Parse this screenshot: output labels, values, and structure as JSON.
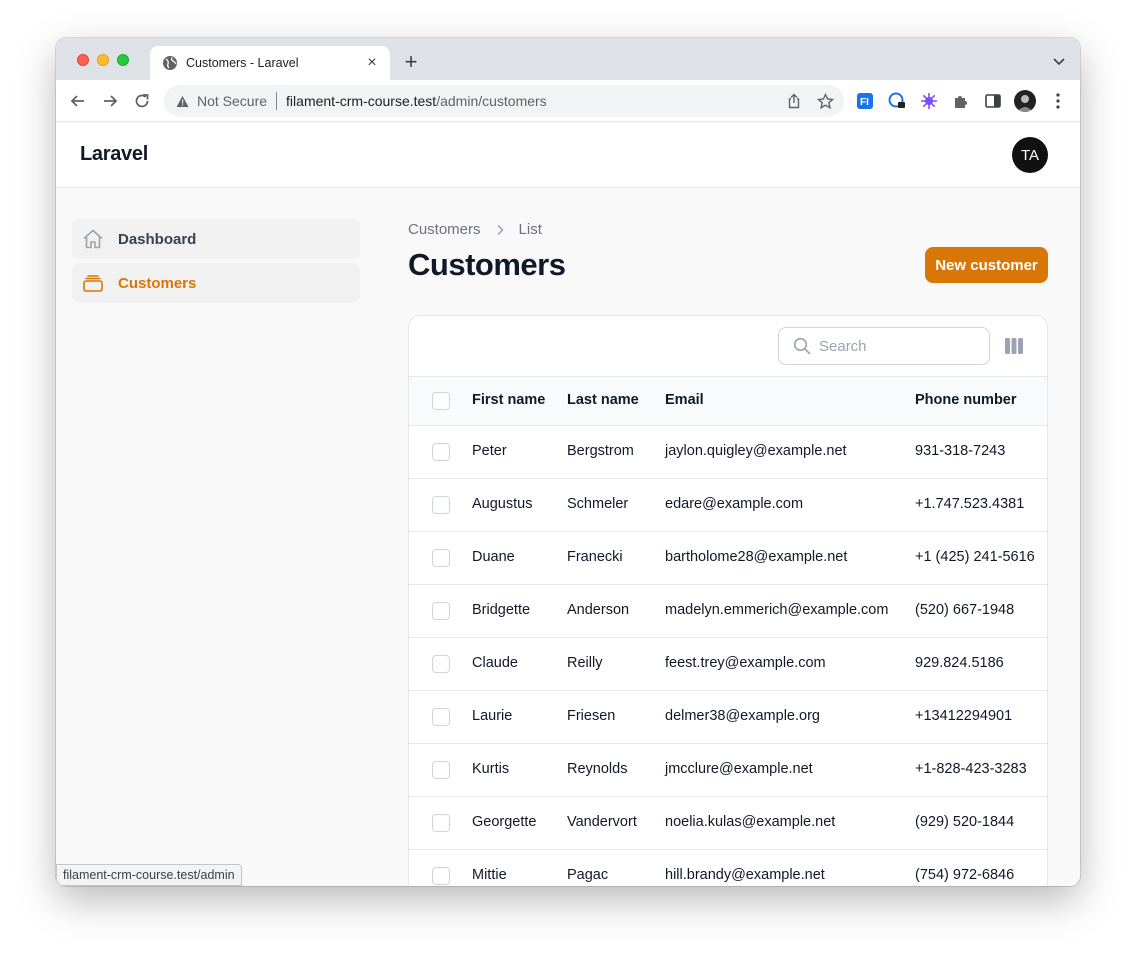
{
  "browser": {
    "tab_title": "Customers - Laravel",
    "new_tab_symbol": "+",
    "close_symbol": "×",
    "security_text": "Not Secure",
    "url_host": "filament-crm-course.test",
    "url_path": "/admin/customers",
    "status_url": "filament-crm-course.test/admin"
  },
  "app": {
    "brand": "Laravel",
    "user_initials": "TA",
    "accent_color": "#d97706"
  },
  "sidebar": {
    "items": [
      {
        "label": "Dashboard",
        "icon": "home-icon",
        "active": false
      },
      {
        "label": "Customers",
        "icon": "rectangle-stack-icon",
        "active": true
      }
    ]
  },
  "main": {
    "breadcrumb": [
      "Customers",
      "List"
    ],
    "title": "Customers",
    "new_button": "New customer",
    "search_placeholder": "Search"
  },
  "table": {
    "columns": [
      "First name",
      "Last name",
      "Email",
      "Phone number"
    ],
    "rows": [
      [
        "Peter",
        "Bergstrom",
        "jaylon.quigley@example.net",
        "931-318-7243"
      ],
      [
        "Augustus",
        "Schmeler",
        "edare@example.com",
        "+1.747.523.4381"
      ],
      [
        "Duane",
        "Franecki",
        "bartholome28@example.net",
        "+1 (425) 241-5616"
      ],
      [
        "Bridgette",
        "Anderson",
        "madelyn.emmerich@example.com",
        "(520) 667-1948"
      ],
      [
        "Claude",
        "Reilly",
        "feest.trey@example.com",
        "929.824.5186"
      ],
      [
        "Laurie",
        "Friesen",
        "delmer38@example.org",
        "+13412294901"
      ],
      [
        "Kurtis",
        "Reynolds",
        "jmcclure@example.net",
        "+1-828-423-3283"
      ],
      [
        "Georgette",
        "Vandervort",
        "noelia.kulas@example.net",
        "(929) 520-1844"
      ],
      [
        "Mittie",
        "Pagac",
        "hill.brandy@example.net",
        "(754) 972-6846"
      ]
    ]
  }
}
